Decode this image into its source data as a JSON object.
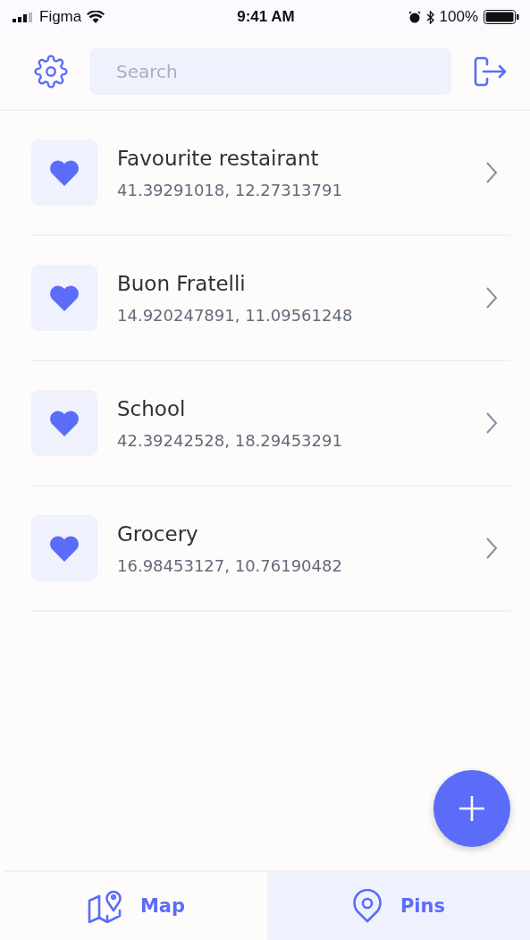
{
  "status_bar": {
    "carrier": "Figma",
    "time": "9:41 AM",
    "battery": "100%"
  },
  "search": {
    "placeholder": "Search"
  },
  "pins": [
    {
      "name": "Favourite restairant",
      "coords": "41.39291018, 12.27313791"
    },
    {
      "name": "Buon Fratelli",
      "coords": "14.920247891, 11.09561248"
    },
    {
      "name": "School",
      "coords": "42.39242528, 18.29453291"
    },
    {
      "name": "Grocery",
      "coords": "16.98453127, 10.76190482"
    }
  ],
  "tabs": [
    {
      "label": "Map",
      "kind": "map",
      "selected": false
    },
    {
      "label": "Pins",
      "kind": "pin",
      "selected": true
    }
  ]
}
